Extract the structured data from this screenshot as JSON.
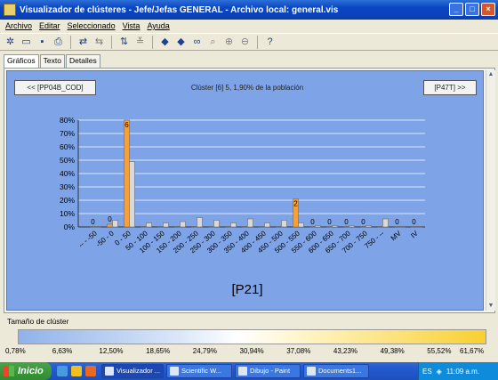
{
  "window": {
    "title": "Visualizador de clústeres - Jefe/Jefas GENERAL - Archivo local: general.vis"
  },
  "menu": [
    "Archivo",
    "Editar",
    "Seleccionado",
    "Vista",
    "Ayuda"
  ],
  "toolbar_icons": [
    "new-icon",
    "open-icon",
    "save-icon",
    "print-icon",
    "swap-icon",
    "swap-back-icon",
    "sort-icon",
    "filter-icon",
    "arrow-left-icon",
    "arrow-right-icon",
    "binoculars-icon",
    "zoom-region-icon",
    "zoom-in-icon",
    "zoom-out-icon",
    "help-icon"
  ],
  "tabs": [
    "Gráficos",
    "Texto",
    "Detalles"
  ],
  "nav": {
    "prev": "<< [PP04B_COD]",
    "next": "[P47T] >>"
  },
  "cluster_title": "Clúster [6] 5, 1,90% de la población",
  "chart_data": {
    "type": "bar",
    "title": "Clúster [6] 5, 1,90% de la población",
    "xlabel": "[P21]",
    "ylabel": "",
    "ylim": [
      0,
      80
    ],
    "yticks": [
      "0%",
      "10%",
      "20%",
      "30%",
      "40%",
      "50%",
      "60%",
      "70%",
      "80%"
    ],
    "categories": [
      "-- - -50",
      "-50 - 0",
      "0 - 50",
      "50 - 100",
      "100 - 150",
      "150 - 200",
      "200 - 250",
      "250 - 300",
      "300 - 350",
      "350 - 400",
      "400 - 450",
      "450 - 500",
      "500 - 550",
      "550 - 600",
      "600 - 650",
      "650 - 700",
      "700 - 750",
      "750 - --",
      "MV",
      "IV"
    ],
    "series": [
      {
        "values": [
          0,
          2,
          80,
          0,
          0,
          0,
          0,
          0,
          0,
          0,
          0,
          0,
          21,
          0,
          0,
          0,
          0,
          0,
          0,
          0
        ],
        "color": "#f5a03a"
      },
      {
        "values": [
          0,
          5,
          49,
          3,
          3,
          4,
          7,
          5,
          3,
          6,
          3,
          5,
          3,
          1,
          1,
          1,
          1,
          6,
          0,
          0
        ],
        "color": "#d9d9d9"
      }
    ],
    "labels": [
      "0",
      "0",
      "6",
      "",
      "",
      "",
      "",
      "",
      "",
      "",
      "",
      "",
      "2",
      "0",
      "0",
      "0",
      "0",
      "",
      "0",
      "0"
    ],
    "grid": true
  },
  "size_section": {
    "label": "Tamaño de clúster",
    "ticks": [
      "0,78%",
      "6,63%",
      "12,50%",
      "18,65%",
      "24,79%",
      "30,94%",
      "37,08%",
      "43,23%",
      "49,38%",
      "55,52%",
      "61,67%"
    ]
  },
  "taskbar": {
    "start": "Inicio",
    "tasks": [
      "Visualizador ...",
      "Scientific W...",
      "Dibujo - Paint",
      "Documents1..."
    ],
    "lang": "ES",
    "time": "11:09 a.m."
  }
}
